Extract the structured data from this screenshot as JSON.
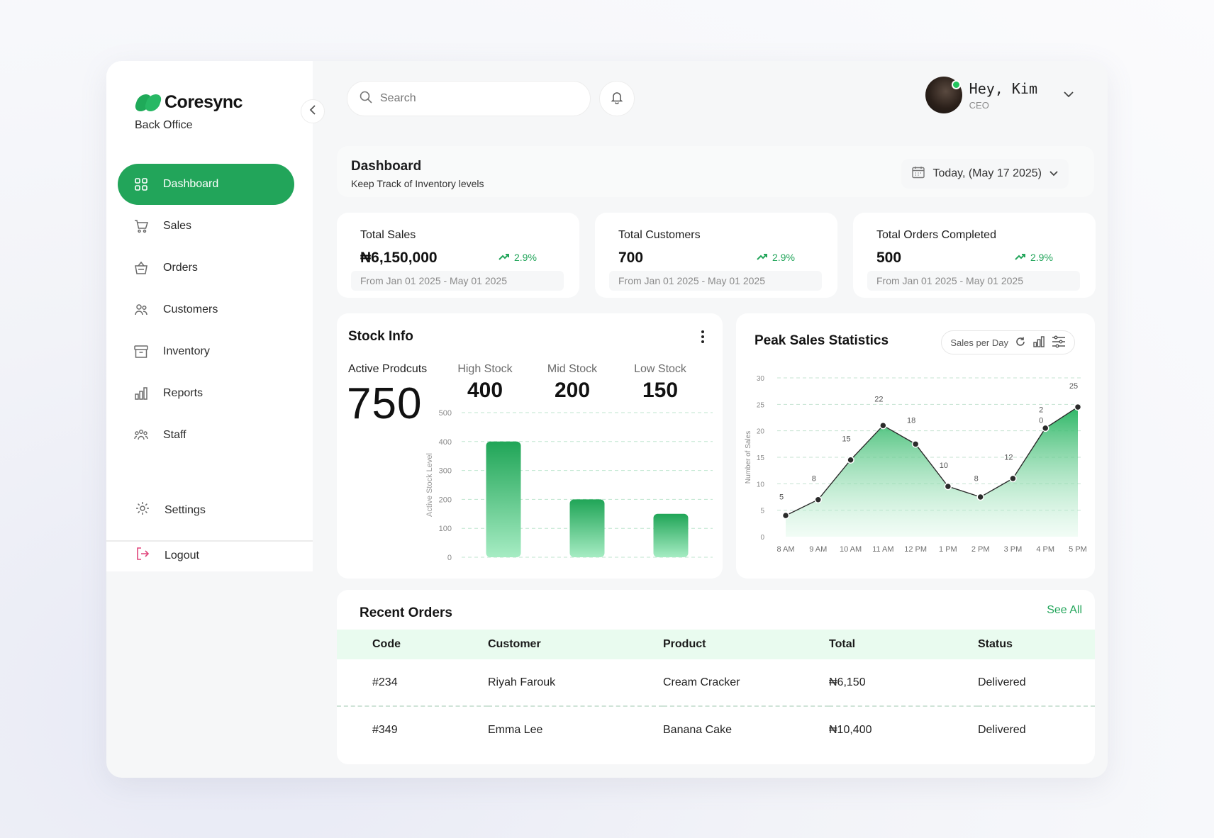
{
  "brand": {
    "name": "Coresync",
    "subtitle": "Back Office"
  },
  "sidebar": {
    "items": [
      {
        "label": "Dashboard",
        "icon": "grid-icon",
        "active": true
      },
      {
        "label": "Sales",
        "icon": "cart-icon"
      },
      {
        "label": "Orders",
        "icon": "basket-icon"
      },
      {
        "label": "Customers",
        "icon": "users-icon"
      },
      {
        "label": "Inventory",
        "icon": "archive-icon"
      },
      {
        "label": "Reports",
        "icon": "bar-chart-icon"
      },
      {
        "label": "Staff",
        "icon": "team-icon"
      }
    ],
    "settings_label": "Settings",
    "logout_label": "Logout"
  },
  "topbar": {
    "search_placeholder": "Search",
    "greeting": "Hey, Kim",
    "role": "CEO"
  },
  "header": {
    "title": "Dashboard",
    "subtitle": "Keep Track of Inventory levels",
    "date": "Today, (May 17 2025)"
  },
  "stats": [
    {
      "label": "Total Sales",
      "value": "₦6,150,000",
      "trend": "2.9%",
      "range": "From Jan 01 2025 - May 01 2025"
    },
    {
      "label": "Total Customers",
      "value": "700",
      "trend": "2.9%",
      "range": "From Jan 01 2025 - May 01 2025"
    },
    {
      "label": "Total Orders Completed",
      "value": "500",
      "trend": "2.9%",
      "range": "From Jan 01 2025 - May 01 2025"
    }
  ],
  "stock": {
    "title": "Stock Info",
    "active_label": "Active Prodcuts",
    "active_value": "750",
    "high_label": "High Stock",
    "high_value": "400",
    "mid_label": "Mid Stock",
    "mid_value": "200",
    "low_label": "Low Stock",
    "low_value": "150"
  },
  "peak": {
    "title": "Peak Sales Statistics",
    "selector": "Sales per Day"
  },
  "colors": {
    "accent": "#22a55a",
    "accent_light": "#e9fbef",
    "logout": "#e0457b"
  },
  "chart_data": [
    {
      "type": "bar",
      "ylabel": "Active Stock Level",
      "ylim": [
        0,
        500
      ],
      "yticks": [
        0,
        100,
        200,
        300,
        400,
        500
      ],
      "categories": [
        "High Stock",
        "Mid Stock",
        "Low Stock"
      ],
      "values": [
        400,
        200,
        150
      ],
      "grid": true
    },
    {
      "type": "area",
      "ylabel": "Number of Sales",
      "ylim": [
        0,
        30
      ],
      "yticks": [
        0,
        5,
        10,
        15,
        20,
        25,
        30
      ],
      "x": [
        "8 AM",
        "9 AM",
        "10 AM",
        "11 AM",
        "12 PM",
        "1 PM",
        "2 PM",
        "3 PM",
        "4 PM",
        "5 PM"
      ],
      "values": [
        4,
        7,
        14.5,
        21,
        17.5,
        9.5,
        7.5,
        11,
        20.5,
        24.5
      ],
      "data_labels": [
        {
          "text": "5",
          "x": "8 AM",
          "y": 7
        },
        {
          "text": "8",
          "x": "9 AM",
          "y": 10.5
        },
        {
          "text": "15",
          "x": "10 AM",
          "y": 18
        },
        {
          "text": "22",
          "x": "11 AM",
          "y": 25.5
        },
        {
          "text": "18",
          "x": "12 PM",
          "y": 21.5
        },
        {
          "text": "10",
          "x": "1 PM",
          "y": 13
        },
        {
          "text": "8",
          "x": "2 PM",
          "y": 10.5
        },
        {
          "text": "12",
          "x": "3 PM",
          "y": 14.5
        },
        {
          "text": "2",
          "x": "4 PM",
          "y": 23.5
        },
        {
          "text": "0",
          "x": "4 PM",
          "y": 21.5
        },
        {
          "text": "25",
          "x": "5 PM",
          "y": 28
        }
      ],
      "grid": true
    }
  ],
  "orders": {
    "title": "Recent Orders",
    "see_all": "See All",
    "columns": [
      "Code",
      "Customer",
      "Product",
      "Total",
      "Status"
    ],
    "rows": [
      [
        "#234",
        "Riyah Farouk",
        "Cream Cracker",
        "₦6,150",
        "Delivered"
      ],
      [
        "#349",
        "Emma Lee",
        "Banana Cake",
        "₦10,400",
        "Delivered"
      ]
    ]
  }
}
